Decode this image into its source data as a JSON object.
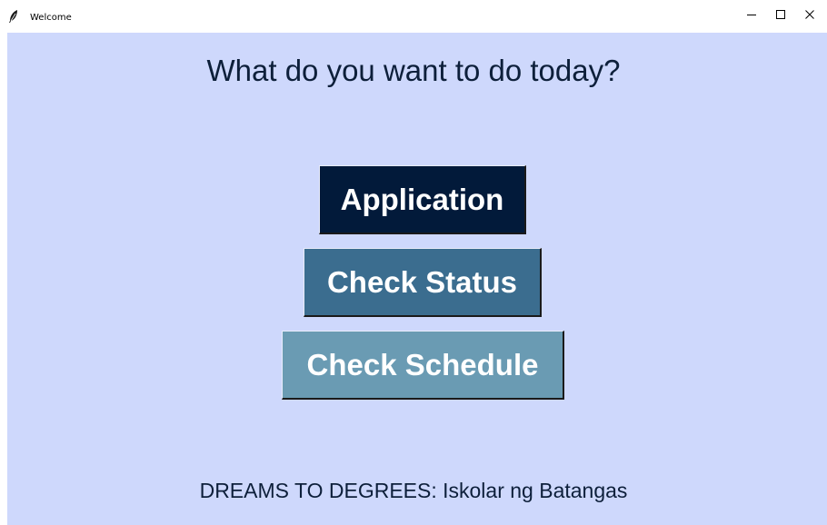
{
  "window": {
    "title": "Welcome",
    "icon": "feather-icon"
  },
  "controls": {
    "minimize_icon": "minimize-icon",
    "maximize_icon": "maximize-icon",
    "close_icon": "close-icon"
  },
  "main": {
    "heading": "What do you want to do today?",
    "buttons": [
      {
        "label": "Application",
        "color": "#021a3a"
      },
      {
        "label": "Check Status",
        "color": "#3b6d8f"
      },
      {
        "label": "Check Schedule",
        "color": "#6a9bb3"
      }
    ],
    "footer": "DREAMS TO DEGREES: Iskolar ng Batangas"
  },
  "colors": {
    "background": "#ced8fc",
    "text": "#0d1f3a"
  }
}
